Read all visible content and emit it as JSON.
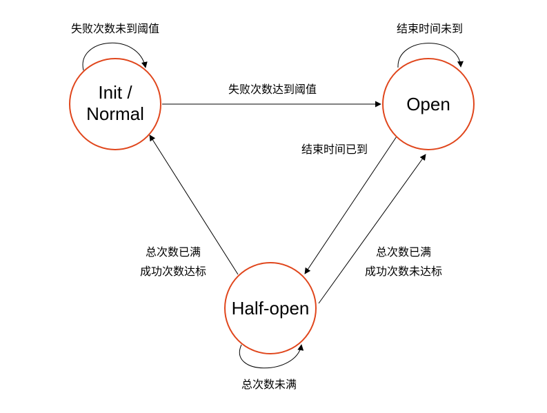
{
  "nodes": {
    "init": {
      "line1": "Init /",
      "line2": "Normal"
    },
    "open": {
      "label": "Open"
    },
    "half_open": {
      "label": "Half-open"
    }
  },
  "edges": {
    "init_self": "失败次数未到阈值",
    "init_to_open": "失败次数达到阈值",
    "open_self": "结束时间未到",
    "open_to_half": "结束时间已到",
    "half_to_init_line1": "总次数已满",
    "half_to_init_line2": "成功次数达标",
    "half_to_open_line1": "总次数已满",
    "half_to_open_line2": "成功次数未达标",
    "half_self": "总次数未满"
  },
  "colors": {
    "node_stroke": "#e0461c",
    "edge": "#000000"
  }
}
